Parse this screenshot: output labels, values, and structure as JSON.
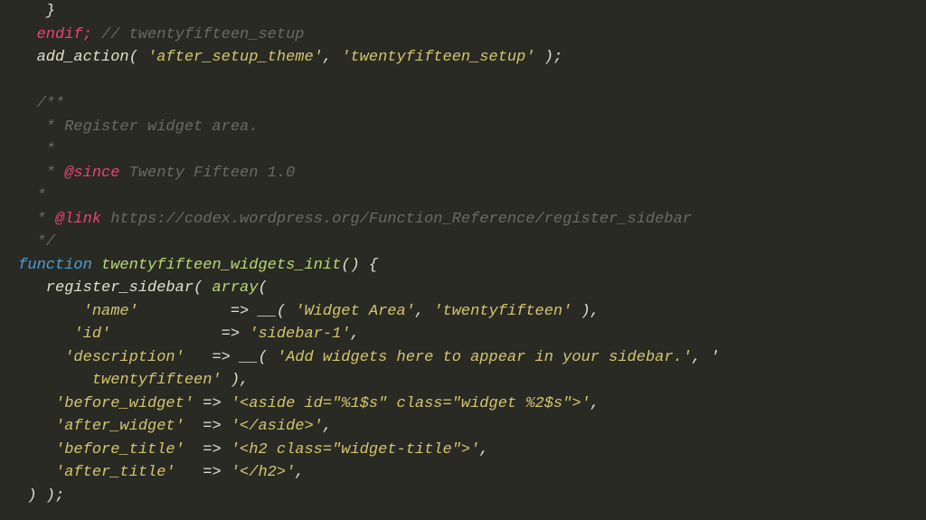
{
  "code": {
    "l1": "    }",
    "l2a": "   endif;",
    "l2b": " // twentyfifteen_setup",
    "l3a": "   add_action( ",
    "l3b": "'after_setup_theme'",
    "l3c": ", ",
    "l3d": "'twentyfifteen_setup'",
    "l3e": " );",
    "l5": "   /**",
    "l6": "    * Register widget area.",
    "l7": "    *",
    "l8a": "    * ",
    "l8b": "@since",
    "l8c": " Twenty Fifteen 1.0",
    "l9": "   *",
    "l10a": "   * ",
    "l10b": "@link",
    "l10c": " https://codex.wordpress.org/Function_Reference/register_sidebar",
    "l11": "   */",
    "l12a": " function",
    "l12b": " twentyfifteen_widgets_init",
    "l12c": "() {",
    "l13a": "    register_sidebar( ",
    "l13b": "array",
    "l13c": "(",
    "l14a": "        'name'",
    "l14b": "          => ",
    "l14c": "__( ",
    "l14d": "'Widget Area'",
    "l14e": ", ",
    "l14f": "'twentyfifteen'",
    "l14g": " ),",
    "l15a": "       'id'",
    "l15b": "            => ",
    "l15c": "'sidebar-1'",
    "l15d": ",",
    "l16a": "      'description'",
    "l16b": "   => ",
    "l16c": "__( ",
    "l16d": "'Add widgets here to appear in your sidebar.'",
    "l16e": ", '",
    "l17a": "         twentyfifteen'",
    "l17b": " ),",
    "l18a": "     'before_widget'",
    "l18b": " => ",
    "l18c": "'<aside id=\"%1$s\" class=\"widget %2$s\">'",
    "l18d": ",",
    "l19a": "     'after_widget'",
    "l19b": "  => ",
    "l19c": "'</aside>'",
    "l19d": ",",
    "l20a": "     'before_title'",
    "l20b": "  => ",
    "l20c": "'<h2 class=\"widget-title\">'",
    "l20d": ",",
    "l21a": "     'after_title'",
    "l21b": "   => ",
    "l21c": "'</h2>'",
    "l21d": ",",
    "l22": "  ) );"
  }
}
